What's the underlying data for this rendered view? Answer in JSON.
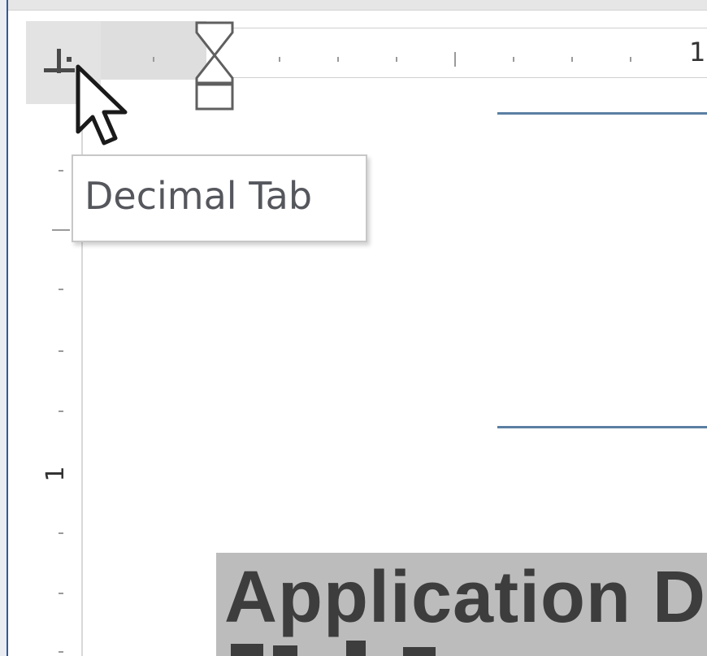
{
  "ruler": {
    "horizontal_label": "1",
    "vertical_label": "1"
  },
  "tab_selector": {
    "icon": "decimal-tab-icon"
  },
  "tooltip": {
    "text": "Decimal Tab"
  },
  "document": {
    "heading": "Application De"
  },
  "colors": {
    "frame_accent": "#2e5a9c",
    "doc_line": "#5b7fa3",
    "heading_highlight": "#bcbcbc",
    "heading_text": "#3d3d3d"
  }
}
